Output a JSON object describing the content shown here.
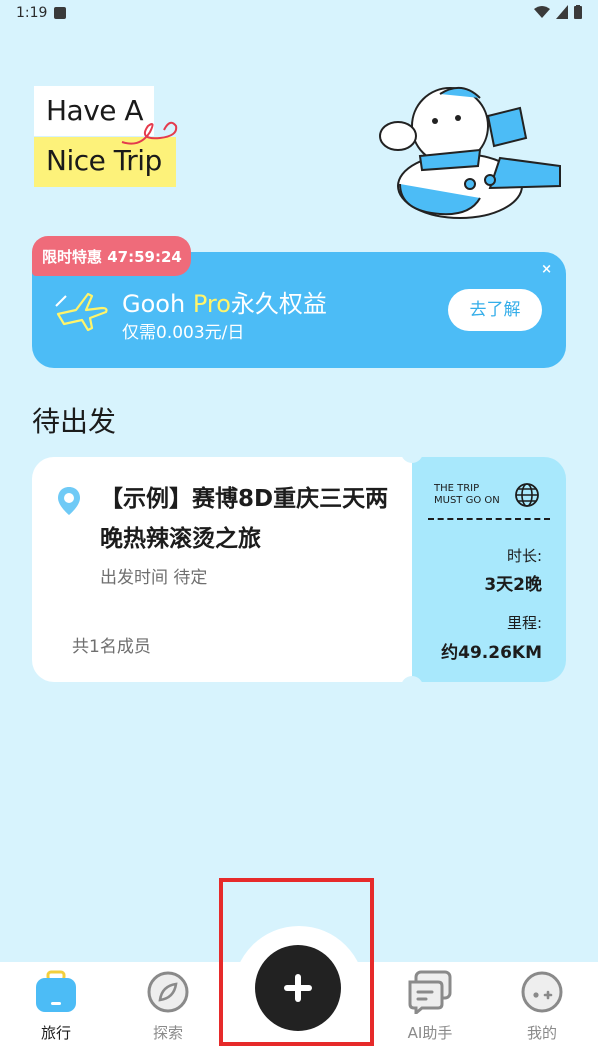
{
  "status_bar": {
    "time": "1:19"
  },
  "hero": {
    "line1": "Have A",
    "line2": "Nice Trip"
  },
  "pro_banner": {
    "timer_label": "限时特惠 47:59:24",
    "close": "×",
    "title_prefix": "Gooh ",
    "title_pro": "Pro",
    "title_suffix": "永久权益",
    "subtitle": "仅需0.003元/日",
    "button": "去了解",
    "accent_color": "#4cbcf6",
    "timer_color": "#ef6b7a"
  },
  "section_title": "待出发",
  "trip": {
    "title": "【示例】赛博8D重庆三天两晚热辣滚烫之旅",
    "depart_label": "出发时间 待定",
    "members": "共1名成员",
    "slogan_line1": "THE TRIP",
    "slogan_line2": "MUST GO ON",
    "duration_label": "时长:",
    "duration_value": "3天2晚",
    "distance_label": "里程:",
    "distance_value": "约49.26KM"
  },
  "nav": {
    "items": [
      {
        "label": "旅行",
        "icon": "suitcase-icon",
        "active": true
      },
      {
        "label": "探索",
        "icon": "compass-icon",
        "active": false
      },
      {
        "label": "AI助手",
        "icon": "chat-icon",
        "active": false
      },
      {
        "label": "我的",
        "icon": "face-icon",
        "active": false
      }
    ],
    "add_icon": "plus-icon"
  }
}
